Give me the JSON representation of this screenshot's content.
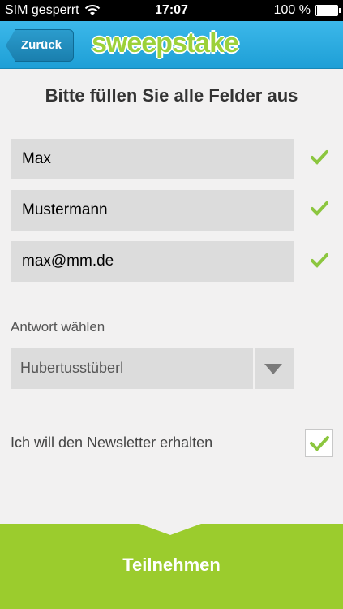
{
  "status_bar": {
    "carrier": "SIM gesperrt",
    "time": "17:07",
    "battery": "100 %",
    "battery_level": 1.0
  },
  "navbar": {
    "back_label": "Zurück",
    "logo": "sweepstake"
  },
  "form": {
    "title": "Bitte füllen Sie alle Felder aus",
    "first_name": "Max",
    "last_name": "Mustermann",
    "email": "max@mm.de",
    "answer_label": "Antwort wählen",
    "answer_value": "Hubertusstüberl",
    "newsletter_label": "Ich will den Newsletter erhalten",
    "newsletter_checked": true
  },
  "footer": {
    "submit_label": "Teilnehmen"
  },
  "colors": {
    "accent": "#9bcc2d",
    "navbar": "#2aaae0",
    "check": "#8cc63f"
  }
}
